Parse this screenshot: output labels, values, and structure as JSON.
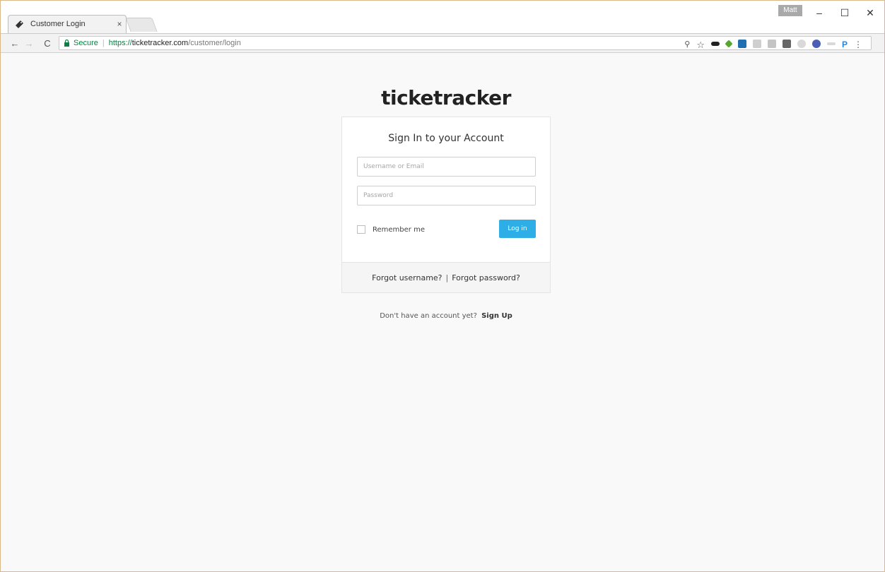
{
  "browser": {
    "tab_title": "Customer Login",
    "tab_close": "×",
    "profile_name": "Matt",
    "window": {
      "minimize": "–",
      "maximize": "☐",
      "close": "✕"
    },
    "nav": {
      "back": "←",
      "forward": "→",
      "reload": "C"
    },
    "omnibox": {
      "secure_label": "Secure",
      "separator": "|",
      "url_scheme": "https://",
      "url_host": "ticketracker.com",
      "url_path": "/customer/login"
    },
    "extensions": {
      "key_icon": "⚲",
      "star_icon": "☆",
      "text_ext": "P",
      "menu_icon": "⋮"
    }
  },
  "page": {
    "logo_text": "ticketracker",
    "card": {
      "title": "Sign In to your Account",
      "username_placeholder": "Username or Email",
      "password_placeholder": "Password",
      "remember_label": "Remember me",
      "login_button": "Log in",
      "forgot_username": "Forgot username?",
      "footer_separator": "|",
      "forgot_password": "Forgot password?"
    },
    "signup_prompt": "Don't have an account yet?",
    "signup_link": "Sign Up"
  },
  "colors": {
    "accent": "#2eaee6",
    "secure_green": "#0b8043",
    "page_bg": "#f9f9f9"
  }
}
